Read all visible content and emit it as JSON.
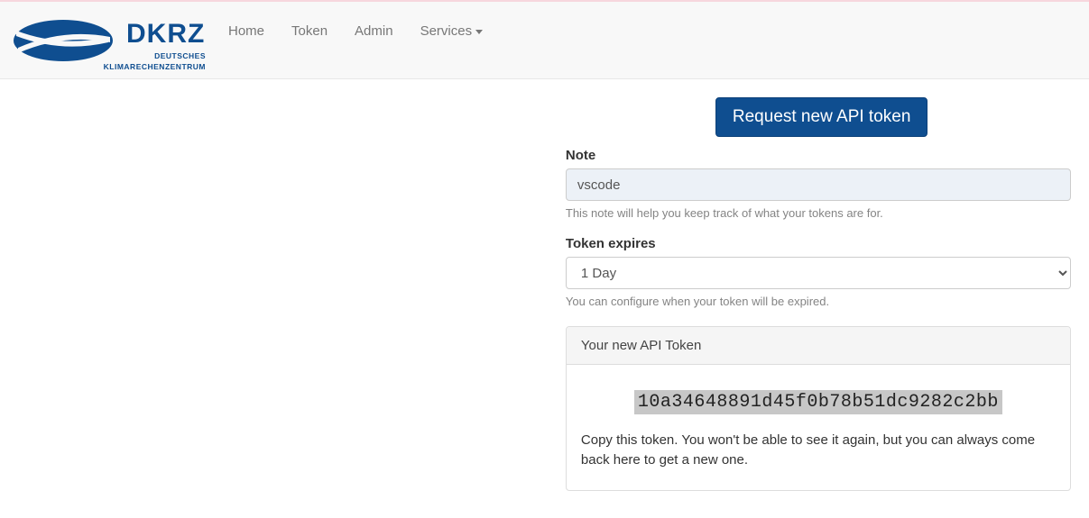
{
  "brand": {
    "name": "DKRZ",
    "sub1": "DEUTSCHES",
    "sub2": "KLIMARECHENZENTRUM"
  },
  "nav": {
    "home": "Home",
    "token": "Token",
    "admin": "Admin",
    "services": "Services"
  },
  "main": {
    "request_button": "Request new API token",
    "note": {
      "label": "Note",
      "value": "vscode",
      "help": "This note will help you keep track of what your tokens are for."
    },
    "expires": {
      "label": "Token expires",
      "selected": "1 Day",
      "help": "You can configure when your token will be expired."
    },
    "result": {
      "heading": "Your new API Token",
      "token": "10a34648891d45f0b78b51dc9282c2bb",
      "instruction": "Copy this token. You won't be able to see it again, but you can always come back here to get a new one."
    }
  }
}
